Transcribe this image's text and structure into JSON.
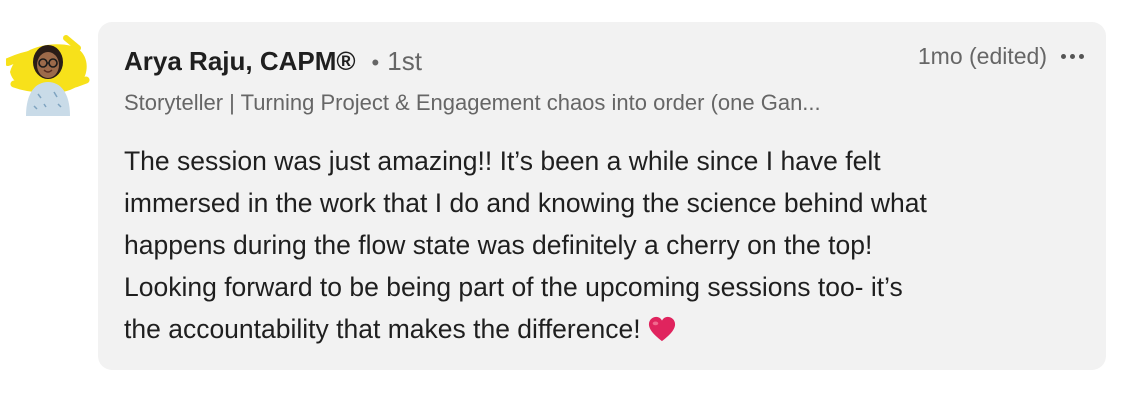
{
  "comment": {
    "author_name": "Arya Raju, CAPM®",
    "separator": "•",
    "connection_degree": "1st",
    "timestamp": "1mo (edited)",
    "headline": "Storyteller | Turning Project & Engagement chaos into order (one Gan...",
    "body_lines": [
      "The session was just amazing!! It’s been a while since I have felt",
      "immersed in the work that I do and knowing the science behind what",
      "happens during the flow state was definitely a cherry on the top!",
      "Looking forward to be being part of the upcoming sessions too- it’s",
      "the accountability that makes the difference!"
    ],
    "emoji": "red-heart-icon",
    "more_options_icon": "more-horizontal-icon",
    "avatar_icon": "profile-photo",
    "colors": {
      "bubble_background": "#f2f2f2",
      "primary_text": "#1f1f1f",
      "secondary_text": "#666666",
      "avatar_highlight": "#f7e11a",
      "heart": "#e0245e"
    }
  }
}
